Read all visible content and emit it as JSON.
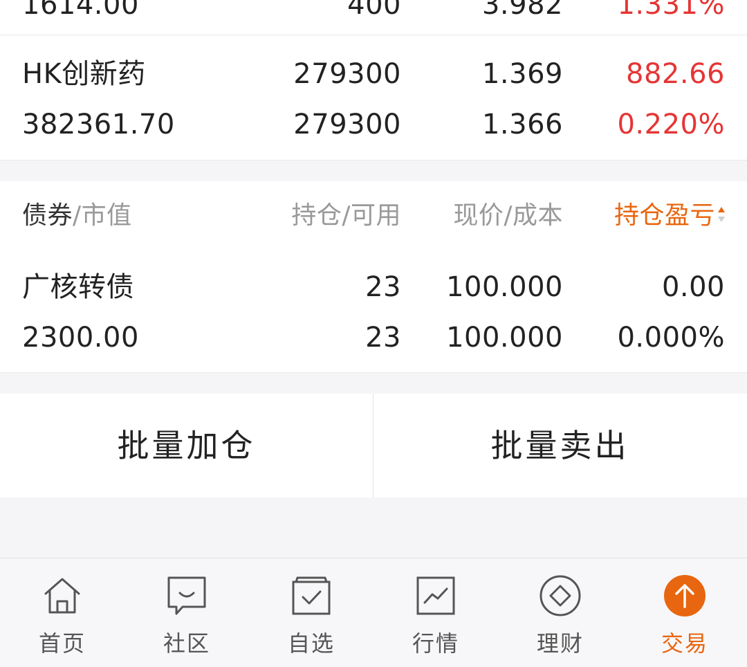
{
  "holdings_top": {
    "cut_row": {
      "c1": "1614.00",
      "c2": "400",
      "c3": "3.982",
      "c4": "1.331%"
    },
    "item": {
      "name": "HK创新药",
      "qty": "279300",
      "price": "1.369",
      "pnl": "882.66",
      "market_value": "382361.70",
      "available": "279300",
      "cost": "1.366",
      "pnl_pct": "0.220%"
    }
  },
  "bonds": {
    "header": {
      "col1_main": "债券",
      "col1_sub": "/市值",
      "col2": "持仓/可用",
      "col3": "现价/成本",
      "col4": "持仓盈亏"
    },
    "item": {
      "name": "广核转债",
      "qty": "23",
      "price": "100.000",
      "pnl": "0.00",
      "market_value": "2300.00",
      "available": "23",
      "cost": "100.000",
      "pnl_pct": "0.000%"
    }
  },
  "actions": {
    "batch_add": "批量加仓",
    "batch_sell": "批量卖出"
  },
  "tabbar": {
    "items": [
      {
        "label": "首页",
        "icon": "home-icon"
      },
      {
        "label": "社区",
        "icon": "community-icon"
      },
      {
        "label": "自选",
        "icon": "watchlist-icon"
      },
      {
        "label": "行情",
        "icon": "market-icon"
      },
      {
        "label": "理财",
        "icon": "wealth-icon"
      },
      {
        "label": "交易",
        "icon": "trade-icon"
      }
    ],
    "active_color": "#e8660f"
  },
  "colors": {
    "up": "#e53535",
    "accent": "#e8660f"
  }
}
